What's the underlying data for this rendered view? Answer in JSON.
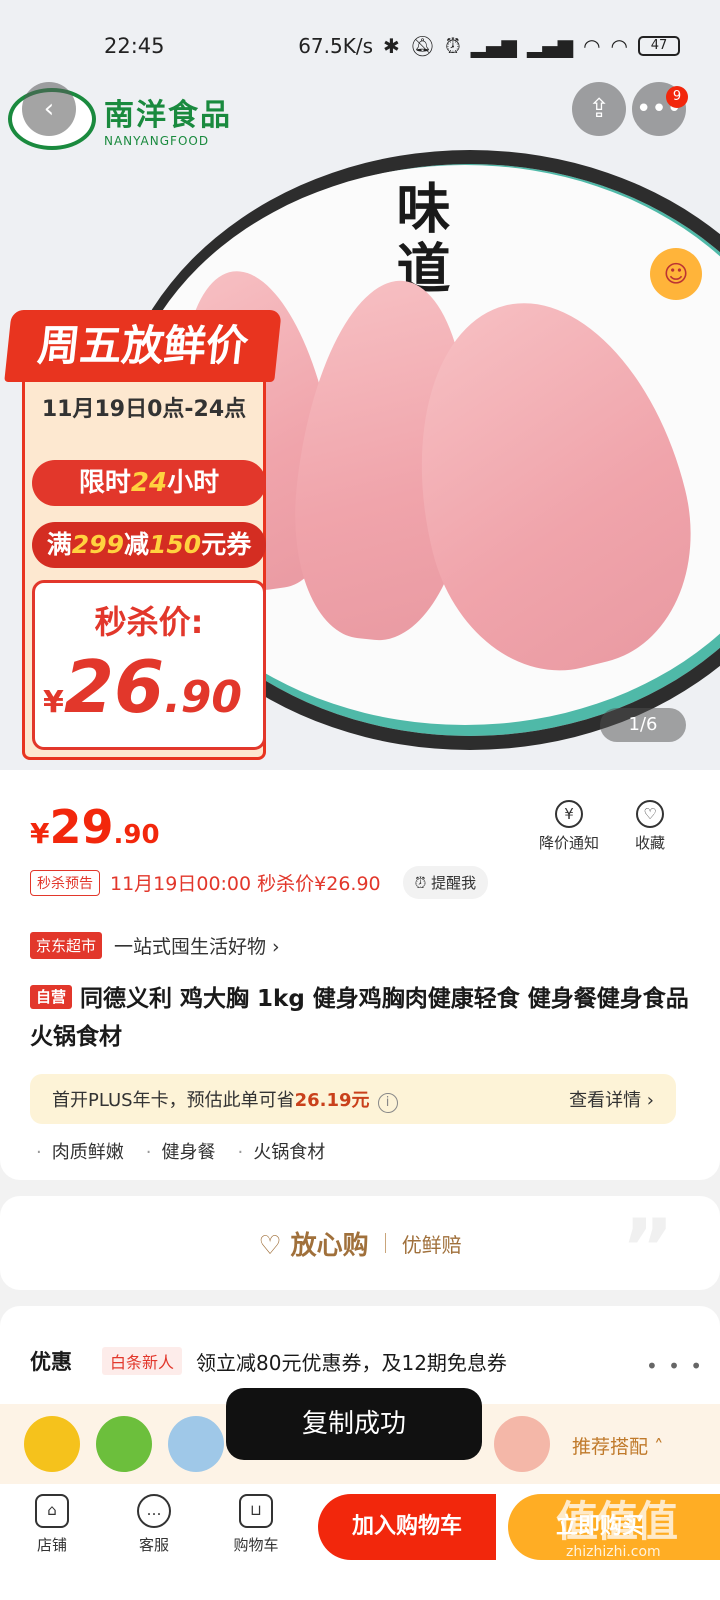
{
  "status_bar": {
    "time": "22:45",
    "net_speed": "67.5K/s",
    "battery": "47"
  },
  "hero": {
    "brand_cn": "南洋食品",
    "brand_en": "NANYANGFOOD",
    "calligraphy": "味道",
    "promo_title": "周五放鲜价",
    "promo_date": "11月19日0点-24点",
    "limited_prefix": "限时",
    "limited_num": "24",
    "limited_suffix": "小时",
    "coupon_prefix": "满",
    "coupon_a": "299",
    "coupon_mid": "减",
    "coupon_b": "150",
    "coupon_suffix": "元券",
    "flash_label": "秒杀价:",
    "flash_currency": "¥",
    "flash_int": "26",
    "flash_dec": ".90",
    "pager": "1/6",
    "more_badge": "9"
  },
  "price": {
    "currency": "¥",
    "int": "29",
    "dec": ".90",
    "notify_label": "降价通知",
    "fav_label": "收藏"
  },
  "seckill": {
    "tag": "秒杀预告",
    "text": "11月19日00:00 秒杀价¥26.90",
    "remind": "提醒我"
  },
  "jd": {
    "tag": "京东超市",
    "text": "一站式囤生活好物 ›"
  },
  "product": {
    "self_tag": "自营",
    "title": "同德义利  鸡大胸 1kg 健身鸡胸肉健康轻食 健身餐健身食品火锅食材"
  },
  "plus": {
    "text": "首开PLUS年卡，预估此单可省",
    "amount": "26.19元",
    "detail": "查看详情 ›"
  },
  "tags": [
    "肉质鲜嫩",
    "健身餐",
    "火锅食材"
  ],
  "assurance": {
    "main": "♡ 放心购",
    "sub": "优鲜赔"
  },
  "discount": {
    "label": "优惠",
    "tag": "白条新人",
    "text": "领立减80元优惠券，及12期免息券",
    "more": "• • •"
  },
  "recommend": {
    "label": "推荐搭配 ˄"
  },
  "toast": "复制成功",
  "bottom": {
    "shop": "店铺",
    "service": "客服",
    "cart": "购物车",
    "add_cart": "加入购物车",
    "buy_now": "立即购买",
    "watermark": "值值值",
    "watermark_url": "zhizhizhi.com"
  },
  "colors": {
    "primary_red": "#f2270c",
    "buy_orange": "#ffad24",
    "assurance_gold": "#a0703b",
    "brand_green": "#1a8a3e"
  }
}
